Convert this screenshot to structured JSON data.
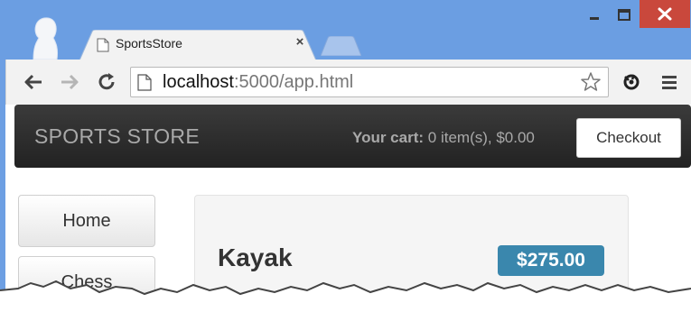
{
  "browser": {
    "tab_title": "SportsStore",
    "tab_close": "×",
    "url_host": "localhost",
    "url_rest": ":5000/app.html"
  },
  "page": {
    "brand": "SPORTS STORE",
    "cart": {
      "label": "Your cart:",
      "summary": "0 item(s), $0.00"
    },
    "checkout_label": "Checkout",
    "categories": [
      {
        "label": "Home"
      },
      {
        "label": "Chess"
      }
    ],
    "product": {
      "name": "Kayak",
      "price": "$275.00"
    }
  },
  "colors": {
    "chrome_blue": "#6b9ee2",
    "navbar_dark": "#222222",
    "price_badge": "#3a87ad",
    "close_red": "#c9483c"
  }
}
